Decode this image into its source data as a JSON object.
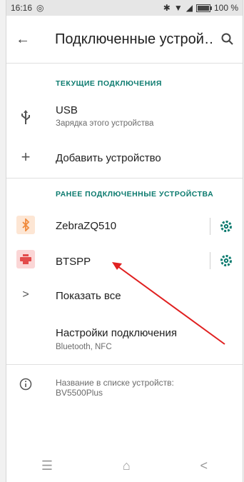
{
  "status": {
    "time": "16:16",
    "battery": "100 %",
    "battery_level": 1.0
  },
  "appbar": {
    "title": "Подключенные устрой…"
  },
  "sections": {
    "current": "ТЕКУЩИЕ ПОДКЛЮЧЕНИЯ",
    "previous": "РАНЕЕ ПОДКЛЮЧЕННЫЕ УСТРОЙСТВА"
  },
  "usb": {
    "title": "USB",
    "subtitle": "Зарядка этого устройства"
  },
  "add_device": {
    "label": "Добавить устройство"
  },
  "devices": [
    {
      "name": "ZebraZQ510"
    },
    {
      "name": "BTSPP"
    }
  ],
  "show_all": {
    "label": "Показать все"
  },
  "conn_settings": {
    "title": "Настройки подключения",
    "subtitle": "Bluetooth, NFC"
  },
  "info": {
    "line1": "Название в списке устройств:",
    "line2": "BV5500Plus"
  },
  "colors": {
    "accent": "#0b7a6e",
    "arrow": "#e02020",
    "bt_bg": "#fde6d4",
    "printer_bg": "#fbd6d6"
  }
}
